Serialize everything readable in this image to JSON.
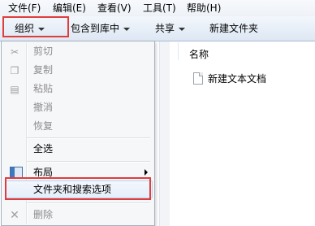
{
  "menubar": {
    "items": [
      {
        "label": "文件(F)"
      },
      {
        "label": "编辑(E)"
      },
      {
        "label": "查看(V)"
      },
      {
        "label": "工具(T)"
      },
      {
        "label": "帮助(H)"
      }
    ]
  },
  "toolbar": {
    "organize": "组织",
    "include_in_library": "包含到库中",
    "share": "共享",
    "new_folder": "新建文件夹"
  },
  "content": {
    "column_name": "名称",
    "files": [
      {
        "name": "新建文本文档",
        "icon": "text-document-icon"
      }
    ]
  },
  "dropdown": {
    "items": [
      {
        "label": "剪切",
        "icon": "scissors-icon",
        "enabled": false
      },
      {
        "label": "复制",
        "icon": "copy-icon",
        "enabled": false
      },
      {
        "label": "粘贴",
        "icon": "paste-icon",
        "enabled": false
      },
      {
        "label": "撤消",
        "enabled": false
      },
      {
        "label": "恢复",
        "enabled": false
      },
      {
        "label": "全选",
        "enabled": true
      },
      {
        "label": "布局",
        "icon": "layout-icon",
        "enabled": true,
        "has_submenu": true
      },
      {
        "label": "文件夹和搜索选项",
        "enabled": true,
        "highlighted": true
      },
      {
        "label": "删除",
        "icon": "delete-icon",
        "enabled": false
      }
    ]
  },
  "colors": {
    "annotation_red": "#e03c3c",
    "menu_background": "#f6f7f9",
    "disabled_text": "#8d8d8d"
  }
}
